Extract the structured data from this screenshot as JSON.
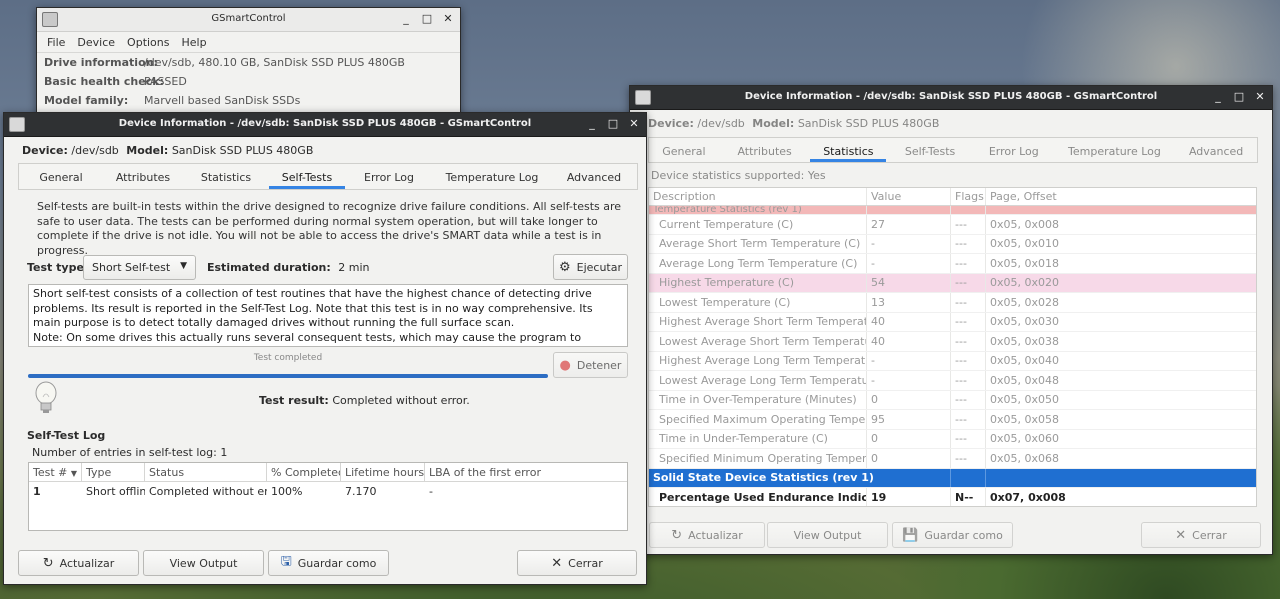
{
  "main_window": {
    "title": "GSmartControl",
    "menu": [
      "File",
      "Device",
      "Options",
      "Help"
    ],
    "drive_info_label": "Drive information:",
    "drive_info_value": "/dev/sdb, 480.10 GB, SanDisk SSD PLUS 480GB",
    "health_label": "Basic health check:",
    "health_value": "PASSED",
    "family_label": "Model family:",
    "family_value": "Marvell based SanDisk SSDs"
  },
  "dev_left": {
    "title": "Device Information - /dev/sdb: SanDisk SSD PLUS 480GB - GSmartControl",
    "device_label": "Device:",
    "device_value": "/dev/sdb",
    "model_label": "Model:",
    "model_value": "SanDisk SSD PLUS 480GB",
    "tabs": [
      "General",
      "Attributes",
      "Statistics",
      "Self-Tests",
      "Error Log",
      "Temperature Log",
      "Advanced"
    ],
    "intro": "Self-tests are built-in tests within the drive designed to recognize drive failure conditions. All self-tests are safe to user data. The tests can be performed during normal system operation, but will take longer to complete if the drive is not idle. You will not be able to access the drive's SMART data while a test is in progress.",
    "test_type_label": "Test type:",
    "test_type_value": "Short Self-test",
    "est_label": "Estimated duration:",
    "est_value": "2 min",
    "execute_btn": "Ejecutar",
    "description": "Short self-test consists of a collection of test routines that have the highest chance of detecting drive problems. Its result is reported in the Self-Test Log. Note that this test is in no way comprehensive. Its main purpose is to detect totally damaged drives without running the full surface scan.\nNote: On some drives this actually runs several consequent tests, which may cause the program to display the test progress incorrectly.",
    "progress_label": "Test completed",
    "progress": 1.0,
    "stop_btn": "Detener",
    "result_label": "Test result:",
    "result_value": "Completed without error.",
    "log_title": "Self-Test Log",
    "log_count": "Number of entries in self-test log: 1",
    "log_columns": [
      "Test #",
      "Type",
      "Status",
      "% Completed",
      "Lifetime hours",
      "LBA of the first error"
    ],
    "log_row": [
      "1",
      "Short offline",
      "Completed without error",
      "100%",
      "7.170",
      "-"
    ],
    "btn_refresh": "Actualizar",
    "btn_view": "View Output",
    "btn_save": "Guardar como",
    "btn_close": "Cerrar"
  },
  "dev_right": {
    "title": "Device Information - /dev/sdb: SanDisk SSD PLUS 480GB - GSmartControl",
    "device_label": "Device:",
    "device_value": "/dev/sdb",
    "model_label": "Model:",
    "model_value": "SanDisk SSD PLUS 480GB",
    "tabs": [
      "General",
      "Attributes",
      "Statistics",
      "Self-Tests",
      "Error Log",
      "Temperature Log",
      "Advanced"
    ],
    "supported": "Device statistics supported: Yes",
    "columns": [
      "Description",
      "Value",
      "Flags",
      "Page, Offset"
    ],
    "partial_group": "Temperature Statistics (rev 1)",
    "rows": [
      [
        "Current Temperature (C)",
        "27",
        "---",
        "0x05, 0x008"
      ],
      [
        "Average Short Term Temperature (C)",
        "-",
        "---",
        "0x05, 0x010"
      ],
      [
        "Average Long Term Temperature (C)",
        "-",
        "---",
        "0x05, 0x018"
      ],
      [
        "Highest Temperature (C)",
        "54",
        "---",
        "0x05, 0x020"
      ],
      [
        "Lowest Temperature (C)",
        "13",
        "---",
        "0x05, 0x028"
      ],
      [
        "Highest Average Short Term Temperature (C)",
        "40",
        "---",
        "0x05, 0x030"
      ],
      [
        "Lowest Average Short Term Temperature (C)",
        "40",
        "---",
        "0x05, 0x038"
      ],
      [
        "Highest Average Long Term Temperature (C)",
        "-",
        "---",
        "0x05, 0x040"
      ],
      [
        "Lowest Average Long Term Temperature (C)",
        "-",
        "---",
        "0x05, 0x048"
      ],
      [
        "Time in Over-Temperature (Minutes)",
        "0",
        "---",
        "0x05, 0x050"
      ],
      [
        "Specified Maximum Operating Temperature (C)",
        "95",
        "---",
        "0x05, 0x058"
      ],
      [
        "Time in Under-Temperature (C)",
        "0",
        "---",
        "0x05, 0x060"
      ],
      [
        "Specified Minimum Operating Temperature (C)",
        "0",
        "---",
        "0x05, 0x068"
      ]
    ],
    "group2": "Solid State Device Statistics (rev 1)",
    "last_row": [
      "Percentage Used Endurance Indicator",
      "19",
      "N--",
      "0x07, 0x008"
    ],
    "btn_refresh": "Actualizar",
    "btn_view": "View Output",
    "btn_save": "Guardar como",
    "btn_close": "Cerrar"
  },
  "colors": {
    "accent": "#3584e4",
    "selection": "#1f6fd1",
    "highlight_row": "#f7d9e8",
    "critical_row": "#f3b8b8"
  }
}
